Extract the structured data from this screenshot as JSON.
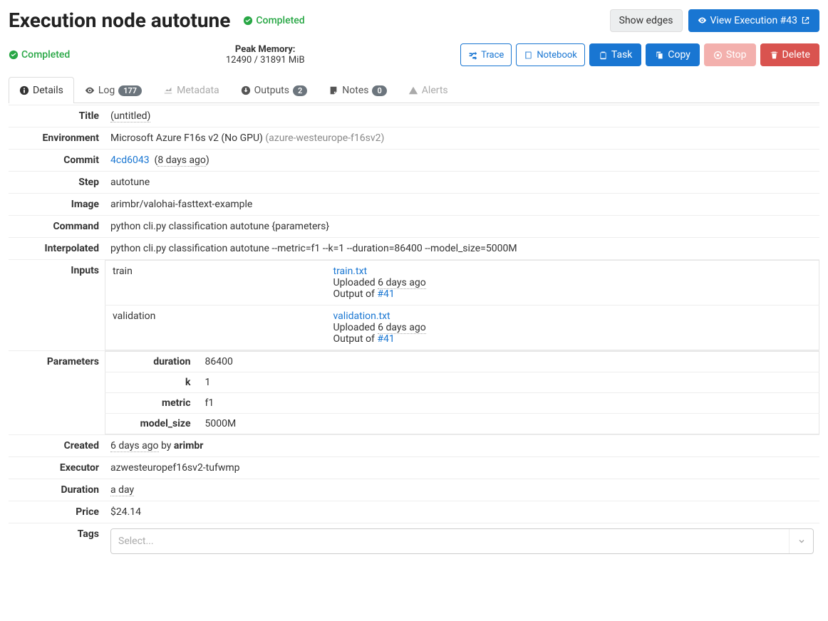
{
  "header": {
    "title": "Execution node autotune",
    "status": "Completed",
    "show_edges": "Show edges",
    "view_execution": "View Execution #43"
  },
  "subheader": {
    "status": "Completed",
    "peak_memory_label": "Peak Memory:",
    "peak_memory_value": "12490 / 31891 MiB",
    "trace": "Trace",
    "notebook": "Notebook",
    "task": "Task",
    "copy": "Copy",
    "stop": "Stop",
    "delete": "Delete"
  },
  "tabs": {
    "details": "Details",
    "log": "Log",
    "log_count": "177",
    "metadata": "Metadata",
    "outputs": "Outputs",
    "outputs_count": "2",
    "notes": "Notes",
    "notes_count": "0",
    "alerts": "Alerts"
  },
  "details": {
    "title_label": "Title",
    "title_value": "(untitled)",
    "environment_label": "Environment",
    "environment_text": "Microsoft Azure F16s v2 (No GPU) ",
    "environment_slug": "(azure-westeurope-f16sv2)",
    "commit_label": "Commit",
    "commit_hash": "4cd6043",
    "commit_ago": "8 days ago",
    "step_label": "Step",
    "step_value": "autotune",
    "image_label": "Image",
    "image_value": "arimbr/valohai-fasttext-example",
    "command_label": "Command",
    "command_value": "python cli.py classification autotune {parameters}",
    "interpolated_label": "Interpolated",
    "interpolated_value": "python cli.py classification autotune --metric=f1 --k=1 --duration=86400 --model_size=5000M",
    "inputs_label": "Inputs",
    "inputs": {
      "train_name": "train",
      "train_file": "train.txt",
      "train_uploaded": "Uploaded ",
      "train_uploaded_ago": "6 days ago",
      "train_output_of": "Output of ",
      "train_output_ref": "#41",
      "validation_name": "validation",
      "validation_file": "validation.txt",
      "validation_uploaded": "Uploaded ",
      "validation_uploaded_ago": "6 days ago",
      "validation_output_of": "Output of ",
      "validation_output_ref": "#41"
    },
    "parameters_label": "Parameters",
    "parameters": {
      "duration_name": "duration",
      "duration_value": "86400",
      "k_name": "k",
      "k_value": "1",
      "metric_name": "metric",
      "metric_value": "f1",
      "model_size_name": "model_size",
      "model_size_value": "5000M"
    },
    "created_label": "Created",
    "created_ago": "6 days ago",
    "created_by": " by ",
    "created_user": "arimbr",
    "executor_label": "Executor",
    "executor_value": "azwesteuropef16sv2-tufwmp",
    "duration_label": "Duration",
    "duration_value": "a day",
    "price_label": "Price",
    "price_value": "$24.14",
    "tags_label": "Tags",
    "tags_placeholder": "Select..."
  }
}
